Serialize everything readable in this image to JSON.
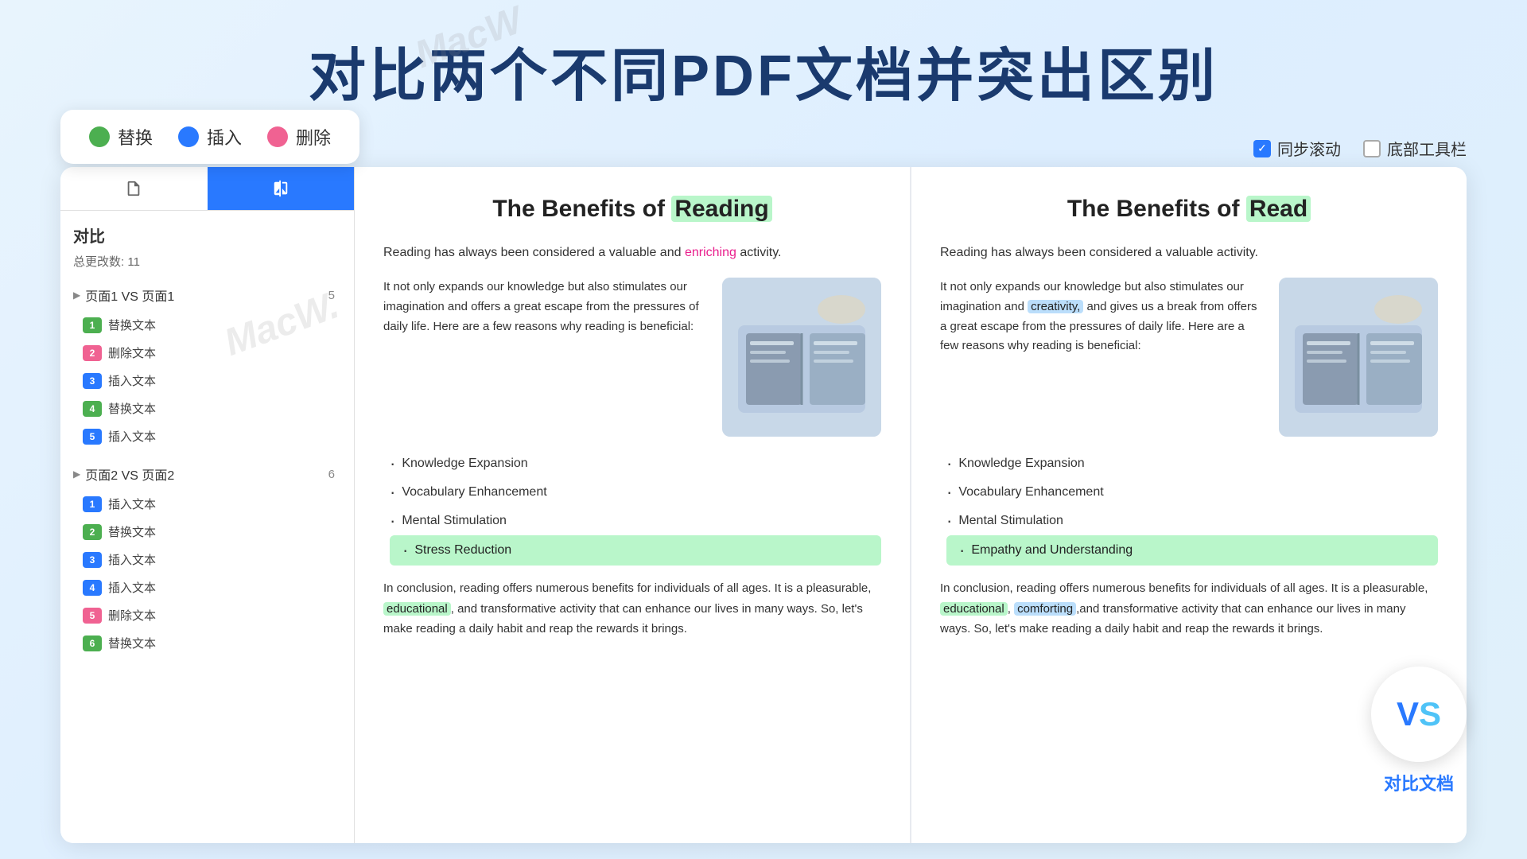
{
  "page": {
    "title": "对比两个不同PDF文档并突出区别",
    "watermarks": [
      "MacW",
      "MacW.",
      "MacW"
    ]
  },
  "legend": {
    "items": [
      {
        "label": "替换",
        "color": "green"
      },
      {
        "label": "插入",
        "color": "blue"
      },
      {
        "label": "删除",
        "color": "red"
      }
    ]
  },
  "controls": {
    "sync_scroll_label": "同步滚动",
    "bottom_toolbar_label": "底部工具栏",
    "sync_scroll_checked": true,
    "bottom_toolbar_checked": false
  },
  "sidebar": {
    "title": "对比",
    "subtitle": "总更改数: 11",
    "groups": [
      {
        "label": "页面1 VS 页面1",
        "count": "5",
        "items": [
          {
            "num": "1",
            "type": "green",
            "label": "替换文本"
          },
          {
            "num": "2",
            "type": "red",
            "label": "删除文本"
          },
          {
            "num": "3",
            "type": "blue",
            "label": "插入文本"
          },
          {
            "num": "4",
            "type": "green",
            "label": "替换文本"
          },
          {
            "num": "5",
            "type": "blue",
            "label": "插入文本"
          }
        ]
      },
      {
        "label": "页面2 VS 页面2",
        "count": "6",
        "items": [
          {
            "num": "1",
            "type": "blue",
            "label": "插入文本"
          },
          {
            "num": "2",
            "type": "green",
            "label": "替换文本"
          },
          {
            "num": "3",
            "type": "blue",
            "label": "插入文本"
          },
          {
            "num": "4",
            "type": "blue",
            "label": "插入文本"
          },
          {
            "num": "5",
            "type": "red",
            "label": "删除文本"
          },
          {
            "num": "6",
            "type": "green",
            "label": "替换文本"
          }
        ]
      }
    ]
  },
  "pdf_left": {
    "title_prefix": "The Benefits of ",
    "title_highlight": "Reading",
    "intro": "Reading has always been considered a valuable and enriching activity.",
    "body": "It not only expands our knowledge but also stimulates our imagination and offers a great escape from the pressures of daily life. Here are a few reasons why reading is beneficial:",
    "bullets": [
      "Knowledge Expansion",
      "Vocabulary Enhancement",
      "Mental Stimulation",
      "Stress Reduction"
    ],
    "conclusion": "In conclusion, reading offers numerous benefits for individuals of all ages. It is a pleasurable, educational, and transformative activity that can enhance our lives in many ways. So, let's make reading a daily habit and reap the rewards it brings."
  },
  "pdf_right": {
    "title_prefix": "The Benefits of ",
    "title_highlight": "Read",
    "intro": "Reading has always been considered a valuable activity.",
    "body": "It not only expands our knowledge but also stimulates our imagination and creativity, and gives us a break from offers a great escape from the pressures of daily life. Here are a few reasons why reading is beneficial:",
    "bullets": [
      "Knowledge Expansion",
      "Vocabulary Enhancement",
      "Mental Stimulation",
      "Empathy and Understanding"
    ],
    "conclusion": "In conclusion, reading offers numerous benefits for individuals of all ages. It is a pleasurable, educational, comforting,and transformative activity that can enhance our lives in many ways. So, let's make reading a daily habit and reap the rewards it brings."
  },
  "vs_badge": {
    "label": "对比文档"
  }
}
